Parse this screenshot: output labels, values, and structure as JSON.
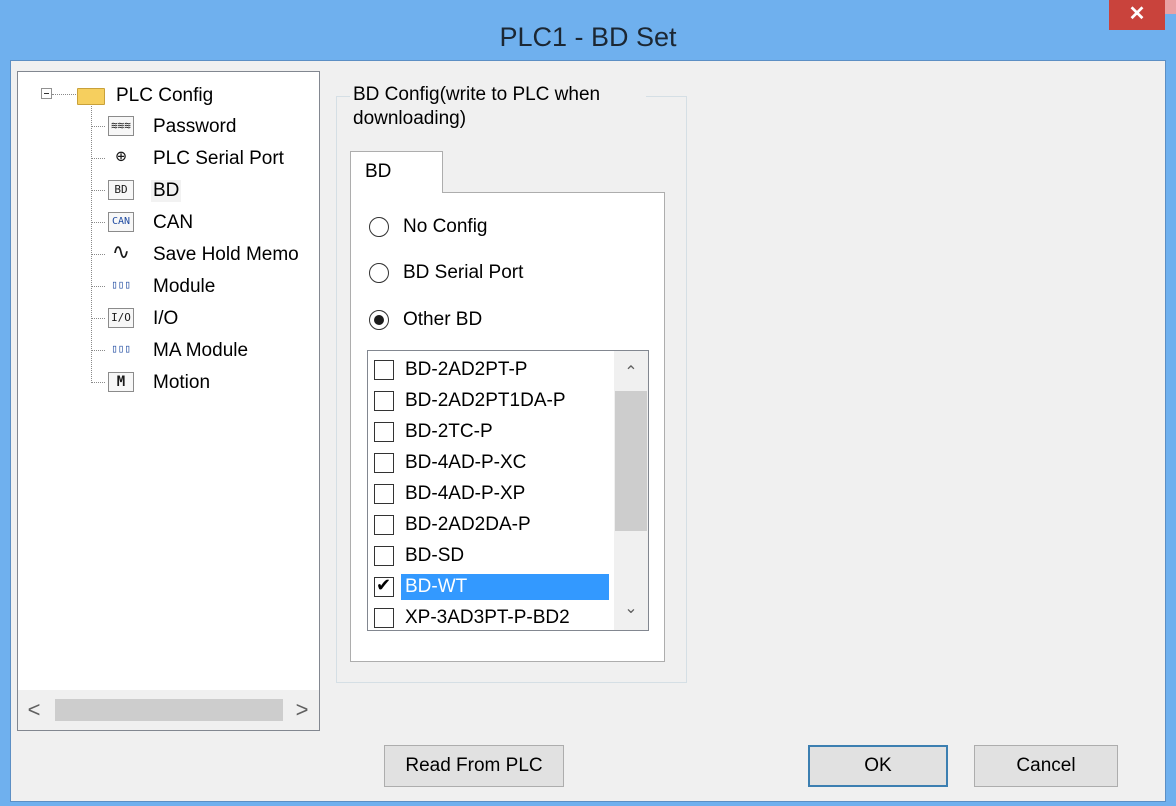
{
  "window": {
    "title": "PLC1 - BD  Set",
    "close_glyph": "✕"
  },
  "tree": {
    "root": "PLC Config",
    "items": [
      {
        "label": "Password",
        "icon": "password-icon",
        "glyph": "≋≋≋"
      },
      {
        "label": "PLC Serial Port",
        "icon": "serial-port-icon",
        "glyph": "⊕"
      },
      {
        "label": "BD",
        "icon": "bd-icon",
        "glyph": "BD"
      },
      {
        "label": "CAN",
        "icon": "can-icon",
        "glyph": "CAN"
      },
      {
        "label": "Save Hold Memo",
        "icon": "waveform-icon",
        "glyph": "∿"
      },
      {
        "label": "Module",
        "icon": "module-icon",
        "glyph": "▯▯▯"
      },
      {
        "label": "I/O",
        "icon": "io-icon",
        "glyph": "I/O"
      },
      {
        "label": "MA Module",
        "icon": "ma-module-icon",
        "glyph": "▯▯▯"
      },
      {
        "label": "Motion",
        "icon": "motion-icon",
        "glyph": "M"
      }
    ],
    "selected": "BD",
    "scroll_left": "<",
    "scroll_right": ">"
  },
  "bd_config": {
    "group_title": "BD Config(write to PLC when downloading)",
    "tab": "BD",
    "options": [
      "No Config",
      "BD Serial Port",
      "Other BD"
    ],
    "selected_option": "Other BD",
    "list": [
      {
        "label": "BD-2AD2PT-P",
        "checked": false
      },
      {
        "label": "BD-2AD2PT1DA-P",
        "checked": false
      },
      {
        "label": "BD-2TC-P",
        "checked": false
      },
      {
        "label": "BD-4AD-P-XC",
        "checked": false
      },
      {
        "label": "BD-4AD-P-XP",
        "checked": false
      },
      {
        "label": "BD-2AD2DA-P",
        "checked": false
      },
      {
        "label": "BD-SD",
        "checked": false
      },
      {
        "label": "BD-WT",
        "checked": true
      },
      {
        "label": "XP-3AD3PT-P-BD2",
        "checked": false
      }
    ],
    "selected_list_item": "BD-WT",
    "scroll_up": "⌃",
    "scroll_down": "⌄"
  },
  "buttons": {
    "read": "Read From PLC",
    "ok": "OK",
    "cancel": "Cancel"
  }
}
